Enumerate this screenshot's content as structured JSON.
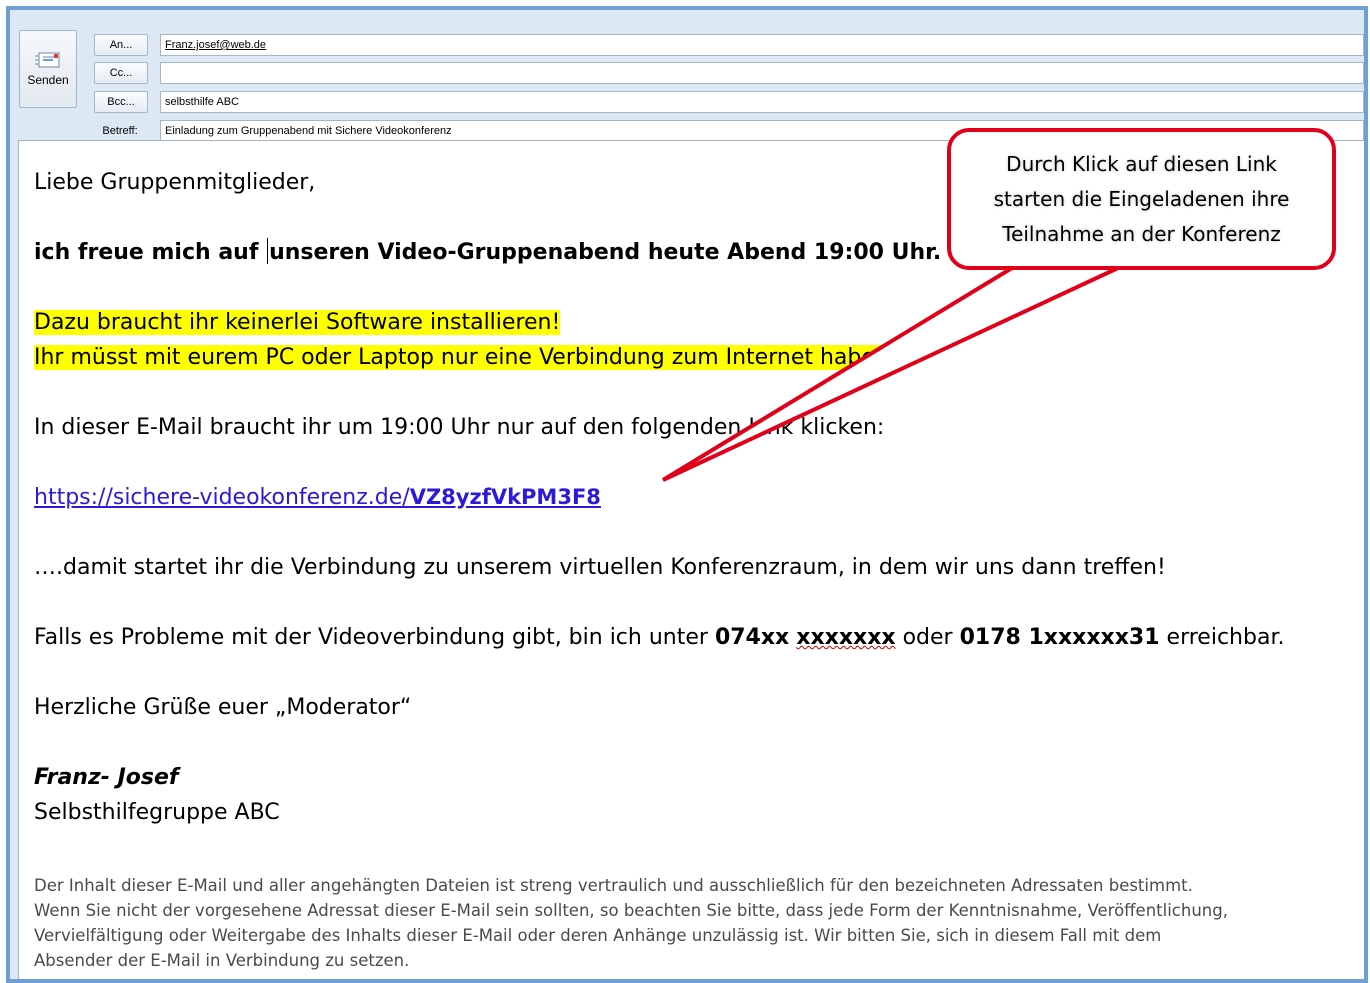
{
  "compose": {
    "send_label": "Senden",
    "to_button": "An...",
    "to_value": "Franz.josef@web.de",
    "cc_button": "Cc...",
    "cc_value": "",
    "bcc_button": "Bcc...",
    "bcc_value": "selbsthilfe ABC",
    "subject_label": "Betreff:",
    "subject_value": "Einladung zum Gruppenabend mit Sichere Videokonferenz"
  },
  "message": {
    "greeting": "Liebe Gruppenmitglieder,",
    "intro_before_cursor": "ich freue mich auf ",
    "intro_after_cursor": "unseren Video-Gruppenabend heute Abend 19:00 Uhr.",
    "highlight_line1": "Dazu braucht ihr keinerlei Software installieren!",
    "highlight_line2": "Ihr müsst mit eurem PC oder Laptop nur eine Verbindung zum Internet haben.",
    "instruction": "In dieser E-Mail braucht ihr um 19:00 Uhr nur auf den folgenden Link klicken:",
    "link_base": "https://sichere-videokonferenz.de/",
    "link_code": "VZ8yzfVkPM3F8",
    "after_link": "….damit startet ihr die Verbindung zu unserem virtuellen Konferenzraum, in dem wir uns dann treffen!",
    "problems_prefix": "Falls es Probleme mit der Videoverbindung gibt, bin ich unter ",
    "phone1_part1": "074xx",
    "phone1_part2": "xxxxxxx",
    "problems_middle": " oder ",
    "phone2": "0178 1xxxxxx31",
    "problems_suffix": " erreichbar.",
    "closing": "Herzliche Grüße euer „Moderator“",
    "signature_name": "Franz- Josef",
    "signature_org": "Selbsthilfegruppe ABC",
    "disclaimer_lines": [
      "Der Inhalt dieser E-Mail und aller angehängten Dateien ist streng vertraulich und ausschließlich für den bezeichneten Adressaten bestimmt.",
      "Wenn Sie nicht der vorgesehene Adressat dieser E-Mail sein sollten, so beachten Sie bitte, dass jede Form der Kenntnisnahme, Veröffentlichung,",
      "Vervielfältigung oder Weitergabe des Inhalts dieser E-Mail oder deren Anhänge unzulässig ist. Wir bitten Sie, sich in diesem Fall mit dem",
      "Absender der E-Mail in Verbindung zu setzen."
    ]
  },
  "callout": {
    "lines": [
      "Durch Klick auf diesen Link",
      "starten die Eingeladenen ihre",
      "Teilnahme an der Konferenz"
    ]
  },
  "colors": {
    "highlight": "#ffff00",
    "link": "#2b1bd9",
    "callout_border": "#e0001a",
    "window_border": "#6f9fd4"
  }
}
